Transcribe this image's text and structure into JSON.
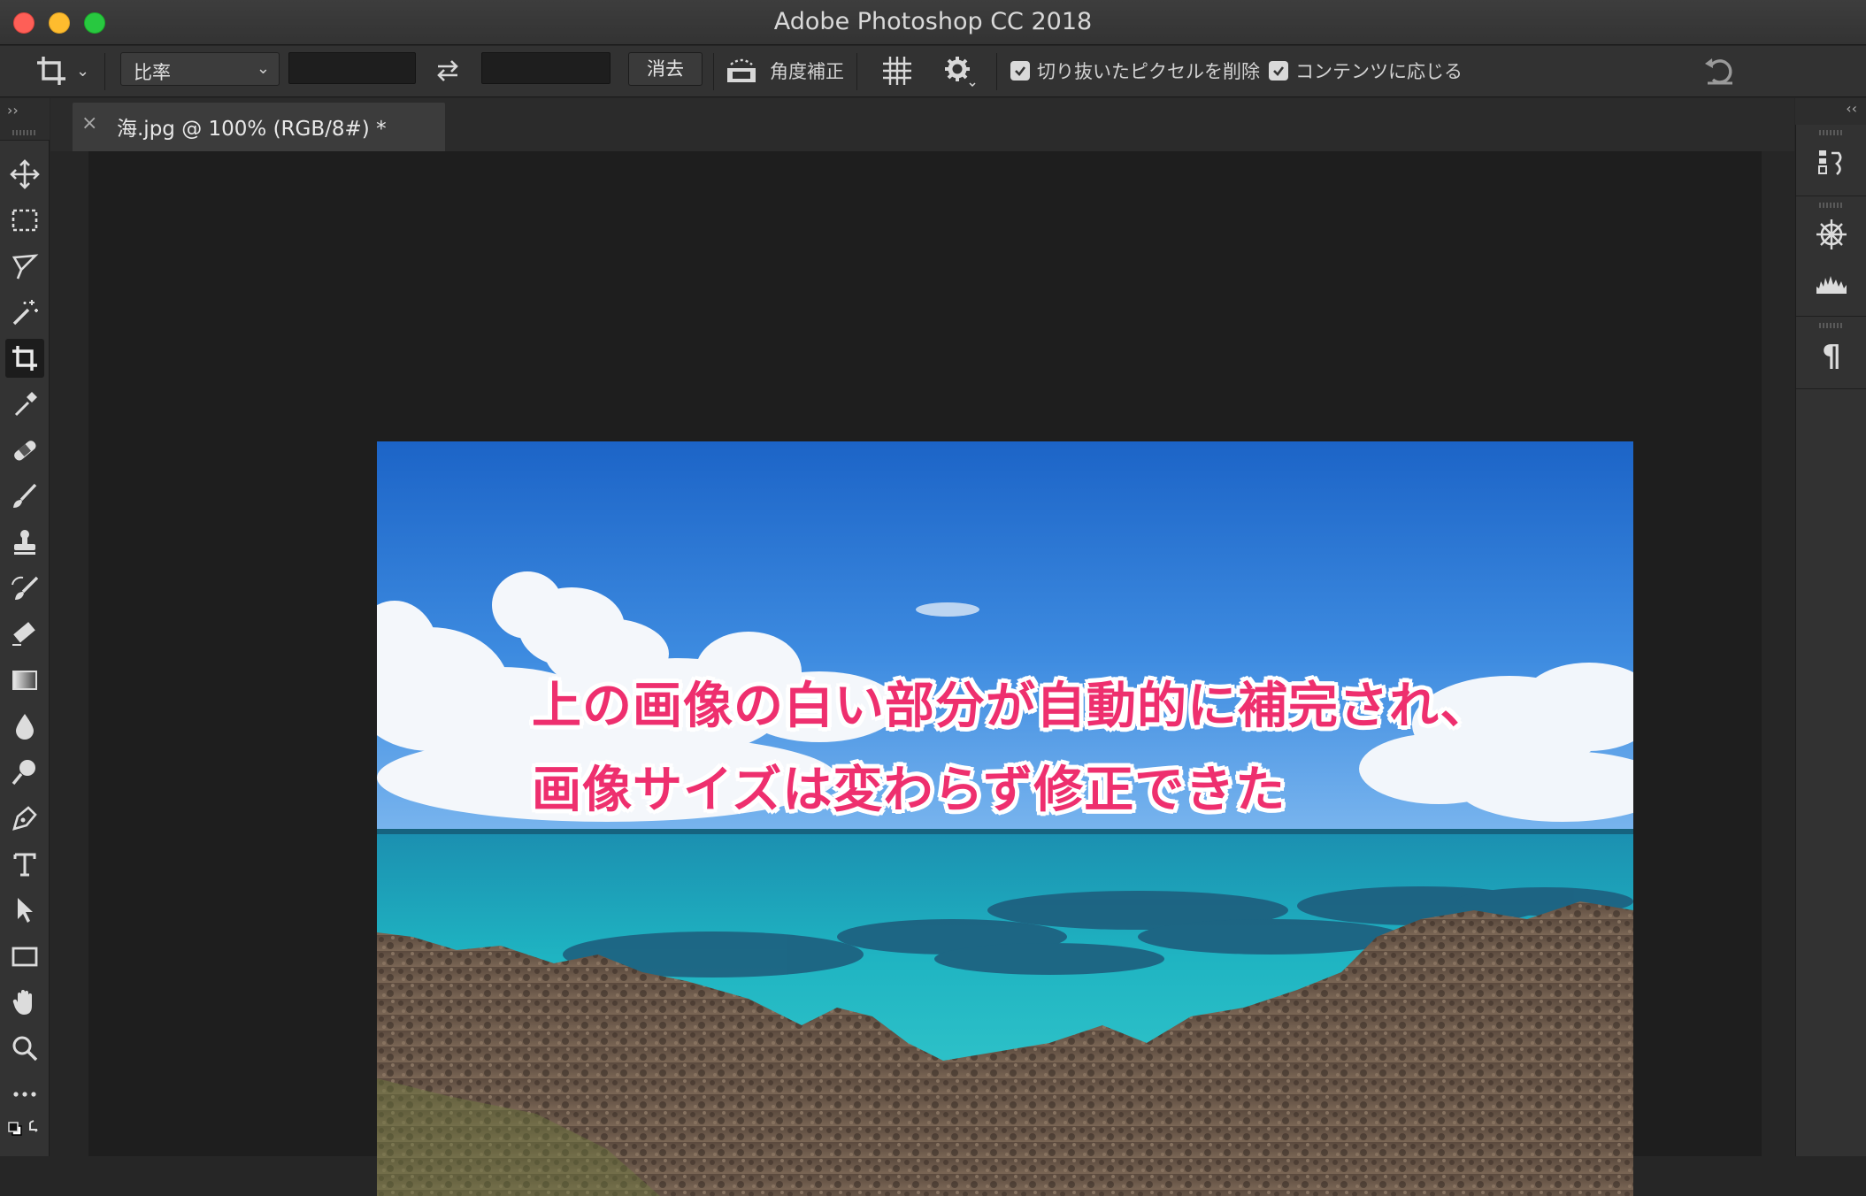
{
  "window": {
    "title": "Adobe Photoshop CC 2018"
  },
  "options_bar": {
    "tool_icon": "crop-icon",
    "ratio_select": "比率",
    "width_value": "",
    "height_value": "",
    "swap_icon": "swap-arrows-icon",
    "clear_button": "消去",
    "straighten_label": "角度補正",
    "overlay_icon": "grid-overlay-icon",
    "settings_icon": "gear-icon",
    "delete_cropped_label": "切り抜いたピクセルを削除",
    "delete_cropped_checked": true,
    "content_aware_label": "コンテンツに応じる",
    "content_aware_checked": true,
    "reset_icon": "undo-icon"
  },
  "document_tab": {
    "close_glyph": "×",
    "title": "海.jpg @ 100% (RGB/8#) *"
  },
  "toolbar": {
    "tools": [
      {
        "name": "move-tool"
      },
      {
        "name": "rectangular-marquee-tool"
      },
      {
        "name": "lasso-tool"
      },
      {
        "name": "magic-wand-tool"
      },
      {
        "name": "crop-tool",
        "active": true
      },
      {
        "name": "eyedropper-tool"
      },
      {
        "name": "healing-brush-tool"
      },
      {
        "name": "brush-tool"
      },
      {
        "name": "clone-stamp-tool"
      },
      {
        "name": "history-brush-tool"
      },
      {
        "name": "eraser-tool"
      },
      {
        "name": "gradient-tool"
      },
      {
        "name": "blur-tool"
      },
      {
        "name": "dodge-tool"
      },
      {
        "name": "pen-tool"
      },
      {
        "name": "type-tool"
      },
      {
        "name": "path-selection-tool"
      },
      {
        "name": "rectangle-tool"
      },
      {
        "name": "hand-tool"
      },
      {
        "name": "zoom-tool"
      },
      {
        "name": "more-tools"
      }
    ]
  },
  "canvas": {
    "overlay_text_line1": "上の画像の白い部分が自動的に補完され、",
    "overlay_text_line2": "画像サイズは変わらず修正できた",
    "overlay_color": "#ee2f6e"
  },
  "right_dock": {
    "icons": [
      "history-panel-icon",
      "navigator-icon",
      "histogram-icon",
      "paragraph-icon"
    ],
    "paragraph_glyph": "¶"
  },
  "colors": {
    "app_background": "#262626",
    "canvas_background": "#1e1e1e",
    "panel": "#323232"
  }
}
